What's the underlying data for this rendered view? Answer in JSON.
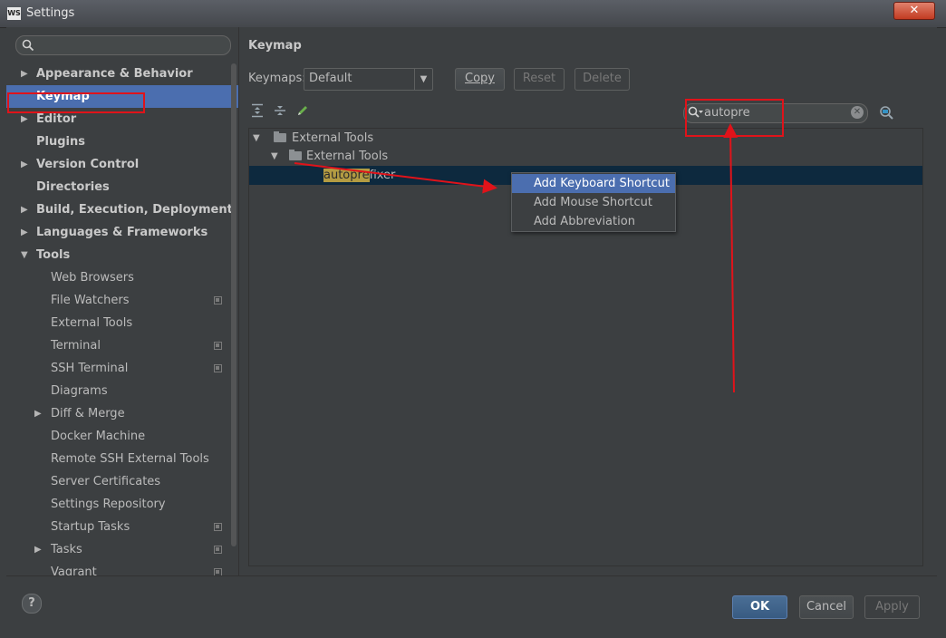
{
  "window": {
    "app_icon_text": "WS",
    "title": "Settings",
    "close_glyph": "✕"
  },
  "sidebar": {
    "search_placeholder": "",
    "items": [
      {
        "label": "Appearance & Behavior",
        "expandable": true
      },
      {
        "label": "Keymap",
        "selected": true
      },
      {
        "label": "Editor",
        "expandable": true
      },
      {
        "label": "Plugins"
      },
      {
        "label": "Version Control",
        "expandable": true
      },
      {
        "label": "Directories"
      },
      {
        "label": "Build, Execution, Deployment",
        "expandable": true
      },
      {
        "label": "Languages & Frameworks",
        "expandable": true
      },
      {
        "label": "Tools",
        "expanded": true
      },
      {
        "label": "Web Browsers"
      },
      {
        "label": "File Watchers",
        "project_icon": true
      },
      {
        "label": "External Tools"
      },
      {
        "label": "Terminal",
        "project_icon": true
      },
      {
        "label": "SSH Terminal",
        "project_icon": true
      },
      {
        "label": "Diagrams"
      },
      {
        "label": "Diff & Merge",
        "expandable": true
      },
      {
        "label": "Docker Machine"
      },
      {
        "label": "Remote SSH External Tools"
      },
      {
        "label": "Server Certificates"
      },
      {
        "label": "Settings Repository"
      },
      {
        "label": "Startup Tasks",
        "project_icon": true
      },
      {
        "label": "Tasks",
        "expandable": true,
        "project_icon": true
      },
      {
        "label": "Vagrant",
        "project_icon": true
      }
    ]
  },
  "panel": {
    "title": "Keymap",
    "keymaps_label": "Keymaps:",
    "keymap_selected": "Default",
    "copy_label": "Copy",
    "reset_label": "Reset",
    "delete_label": "Delete",
    "filter_value": "autopre",
    "tree": {
      "group": "External Tools",
      "subgroup": "External Tools",
      "action_match": "autopre",
      "action_rest": "fixer"
    }
  },
  "context_menu": {
    "items": [
      "Add Keyboard Shortcut",
      "Add Mouse Shortcut",
      "Add Abbreviation"
    ]
  },
  "footer": {
    "help": "?",
    "ok": "OK",
    "cancel": "Cancel",
    "apply": "Apply"
  },
  "colors": {
    "selection": "#4b6eaf",
    "annotation_red": "#e0131a",
    "background": "#3c3f41"
  }
}
